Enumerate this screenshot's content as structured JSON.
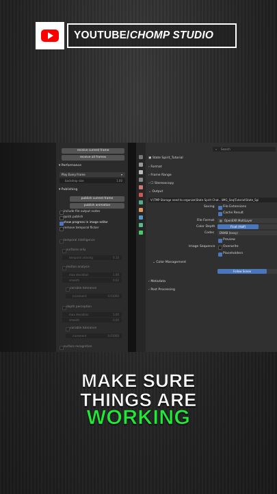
{
  "banner": {
    "channel_prefix": "YOUTUBE/",
    "channel_name": "CHOMP STUDIO"
  },
  "left_panel": {
    "buttons_top": [
      "receive current frame",
      "receive all frames"
    ],
    "performance": {
      "header": "Performance",
      "dropdown": "Play Every Frame",
      "backdrop_label": "backdrop size",
      "backdrop_value": "1.00"
    },
    "publishing": {
      "header": "Publishing",
      "buttons": [
        "publish current frame",
        "publish animation"
      ],
      "options": [
        {
          "label": "include file output nodes",
          "checked": false
        },
        {
          "label": "quick publish",
          "checked": false
        },
        {
          "label": "show progress in image editor",
          "checked": true
        },
        {
          "label": "remove temporal flicker",
          "checked": false
        }
      ]
    },
    "temporal": {
      "header": "temporal intelligence",
      "surfaces_only": "surfaces only",
      "temporal_aliasing": {
        "label": "temporal aliasing",
        "value": "0.10"
      },
      "motion_analysis": "motion analysis",
      "max_deviation_1": {
        "label": "max deviation",
        "value": "1.00"
      },
      "smooth_1": {
        "label": "smooth",
        "value": "0.02"
      },
      "variable_tolerance_1": "variable tolerance",
      "increment_1": {
        "label": "increment",
        "value": "0.01000"
      },
      "depth_perception": "depth perception",
      "max_deviation_2": {
        "label": "max deviation",
        "value": "5.00"
      },
      "smooth_2": {
        "label": "smooth",
        "value": "0.00"
      },
      "variable_tolerance_2": "variable tolerance",
      "increment_2": {
        "label": "increment",
        "value": "0.01000"
      },
      "surface_recognition": "surface recognition"
    }
  },
  "right_panel": {
    "search_placeholder": "Search",
    "breadcrumb": "State Spirit_Tutorial",
    "sections": [
      "Format",
      "Frame Range",
      "Stereoscopy",
      "Output"
    ],
    "output_path": "V:\\TMP Storage need to organize\\State Spirit Chat...\\IMG_Seq\\Tutorial\\State_Spi",
    "saving_label": "Saving",
    "file_extensions": "File Extensions",
    "cache_result": "Cache Result",
    "file_format_label": "File Format",
    "file_format_value": "OpenEXR MultiLayer",
    "color_depth_label": "Color Depth",
    "color_depth_value": "Float (Half)",
    "codec_label": "Codec",
    "codec_value": "DWAB (lossy)",
    "preview": "Preview",
    "image_sequence_label": "Image Sequence",
    "overwrite": "Overwrite",
    "placeholders": "Placeholders",
    "color_management": "Color Management",
    "follow_scene": "Follow Scene",
    "metadata": "Metadata",
    "post_processing": "Post Processing"
  },
  "caption": {
    "line1": "MAKE SURE",
    "line2": "THINGS ARE",
    "line3": "WORKING"
  },
  "colors": {
    "accent_blue": "#4a77bb",
    "caption_green": "#22e83a",
    "youtube_red": "#ff0000"
  }
}
